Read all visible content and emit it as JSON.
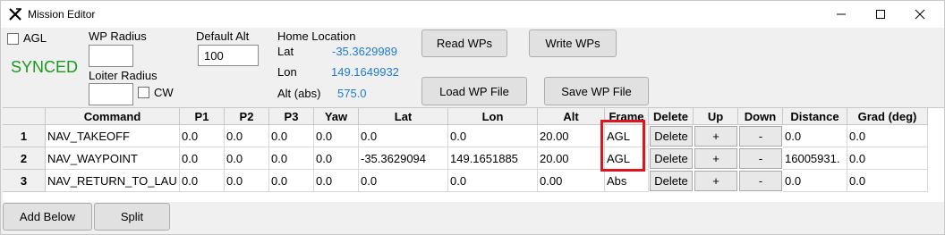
{
  "window": {
    "title": "Mission Editor"
  },
  "options": {
    "agl_label": "AGL",
    "sync_status": "SYNCED",
    "wp_radius_label": "WP Radius",
    "wp_radius_value": "",
    "loiter_radius_label": "Loiter Radius",
    "loiter_radius_value": "",
    "cw_label": "CW",
    "default_alt_label": "Default Alt",
    "default_alt_value": "100"
  },
  "home": {
    "title": "Home Location",
    "lat_label": "Lat",
    "lat_value": "-35.3629989",
    "lon_label": "Lon",
    "lon_value": "149.1649932",
    "alt_label": "Alt (abs)",
    "alt_value": "575.0"
  },
  "buttons": {
    "read_wps": "Read WPs",
    "write_wps": "Write WPs",
    "load_wp_file": "Load WP File",
    "save_wp_file": "Save WP File",
    "add_below": "Add Below",
    "split": "Split"
  },
  "table": {
    "headers": [
      "Command",
      "P1",
      "P2",
      "P3",
      "Yaw",
      "Lat",
      "Lon",
      "Alt",
      "Frame",
      "Delete",
      "Up",
      "Down",
      "Distance",
      "Grad (deg)"
    ],
    "rows": [
      {
        "num": "1",
        "command": "NAV_TAKEOFF",
        "p1": "0.0",
        "p2": "0.0",
        "p3": "0.0",
        "yaw": "0.0",
        "lat": "0.0",
        "lon": "0.0",
        "alt": "20.00",
        "frame": "AGL",
        "delete": "Delete",
        "up": "+",
        "down": "-",
        "distance": "0.0",
        "grad": "0.0"
      },
      {
        "num": "2",
        "command": "NAV_WAYPOINT",
        "p1": "0.0",
        "p2": "0.0",
        "p3": "0.0",
        "yaw": "0.0",
        "lat": "-35.3629094",
        "lon": "149.1651885",
        "alt": "20.00",
        "frame": "AGL",
        "delete": "Delete",
        "up": "+",
        "down": "-",
        "distance": "16005931.",
        "grad": "0.0"
      },
      {
        "num": "3",
        "command": "NAV_RETURN_TO_LAU",
        "p1": "0.0",
        "p2": "0.0",
        "p3": "0.0",
        "yaw": "0.0",
        "lat": "0.0",
        "lon": "0.0",
        "alt": "0.00",
        "frame": "Abs",
        "delete": "Delete",
        "up": "+",
        "down": "-",
        "distance": "0.0",
        "grad": "0.0"
      }
    ]
  },
  "icons": {
    "app": "x-logo-icon",
    "minimize": "minimize-icon",
    "maximize": "maximize-icon",
    "close": "close-icon"
  },
  "colors": {
    "synced": "#1a9a1a",
    "home_values": "#1e7bd6",
    "highlight": "#e0141e"
  }
}
